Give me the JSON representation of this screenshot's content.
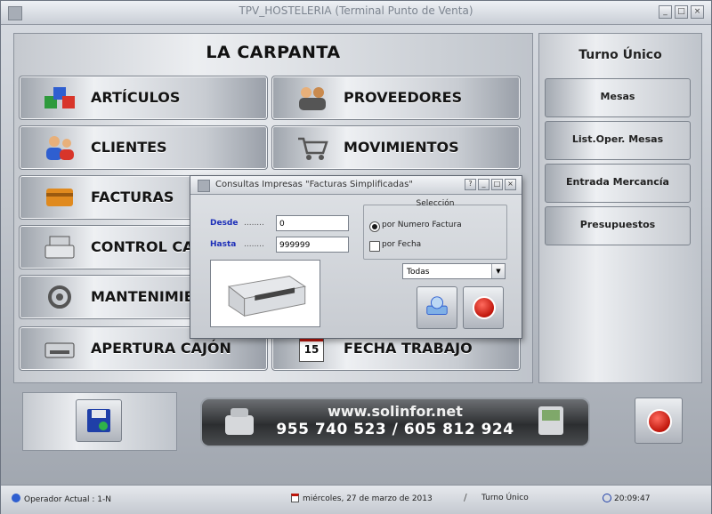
{
  "window": {
    "title": "TPV_HOSTELERIA (Terminal Punto de Venta)",
    "controls": [
      "_",
      "□",
      "×"
    ]
  },
  "main": {
    "shop_name": "LA CARPANTA",
    "buttons": [
      {
        "label": "ARTÍCULOS",
        "icon": "cubes-icon"
      },
      {
        "label": "PROVEEDORES",
        "icon": "suppliers-icon"
      },
      {
        "label": "CLIENTES",
        "icon": "users-icon"
      },
      {
        "label": "MOVIMIENTOS",
        "icon": "cart-icon"
      },
      {
        "label": "FACTURAS",
        "icon": "invoice-icon"
      },
      {
        "label": "CONTROL CA",
        "icon": "cash-register-icon"
      },
      {
        "label": "MANTENIMIEN",
        "icon": "gears-icon"
      },
      {
        "label": "APERTURA CAJÓN",
        "icon": "cash-drawer-icon"
      },
      {
        "label": "FECHA TRABAJO",
        "icon": "calendar-icon",
        "icon_text": "15"
      }
    ]
  },
  "side": {
    "turno": "Turno Único",
    "buttons": [
      "Mesas",
      "List.Oper. Mesas",
      "Entrada Mercancía",
      "Presupuestos"
    ]
  },
  "banner": {
    "url": "www.solinfor.net",
    "phones": "955 740 523  /  605 812 924"
  },
  "dialog": {
    "title": "Consultas Impresas \"Facturas Simplificadas\"",
    "desde_label": "Desde",
    "hasta_label": "Hasta",
    "dots": "........",
    "desde_value": "0",
    "hasta_value": "999999",
    "group_title": "Selección",
    "radio_numero": "por Numero Factura",
    "radio_fecha": "por Fecha",
    "select_value": "Todas",
    "selected_radio": "numero"
  },
  "status": {
    "operator": "Operador Actual : 1-N",
    "date": "miércoles, 27 de marzo de 2013",
    "turno": "Turno Único",
    "time": "20:09:47"
  },
  "colors": {
    "accent_blue": "#1d2fb8",
    "power_red": "#c0160c",
    "banner_dark": "#2c2e30"
  }
}
